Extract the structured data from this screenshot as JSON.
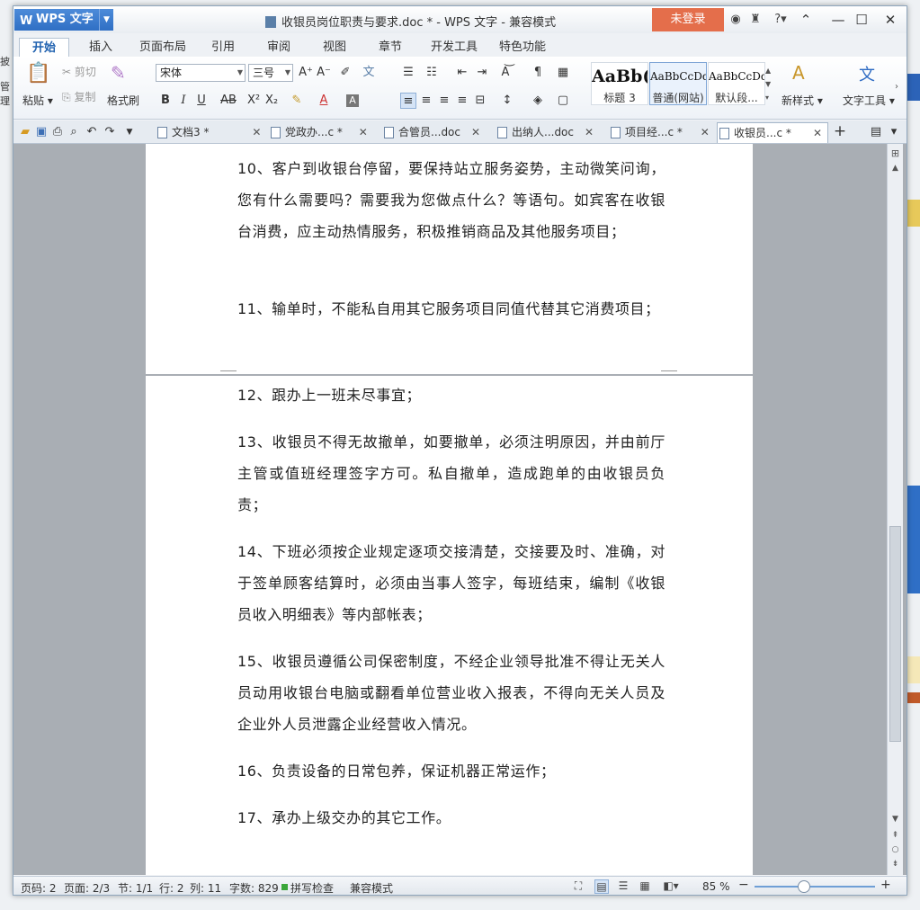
{
  "app": {
    "name": "WPS 文字",
    "window_title": "收银员岗位职责与要求.doc * - WPS 文字 - 兼容模式",
    "login_label": "未登录"
  },
  "desktop": {
    "left_fragments": [
      "披",
      "管理"
    ]
  },
  "ribbon_tabs": [
    {
      "label": "开始",
      "active": true
    },
    {
      "label": "插入"
    },
    {
      "label": "页面布局"
    },
    {
      "label": "引用"
    },
    {
      "label": "审阅"
    },
    {
      "label": "视图"
    },
    {
      "label": "章节"
    },
    {
      "label": "开发工具"
    },
    {
      "label": "特色功能"
    }
  ],
  "ribbon": {
    "paste": "粘贴",
    "cut": "剪切",
    "copy": "复制",
    "format_painter": "格式刷",
    "font_name": "宋体",
    "font_size": "三号",
    "styles": [
      {
        "preview": "AaBb(",
        "label": "标题 3"
      },
      {
        "preview": "AaBbCcDd",
        "label": "普通(网站)",
        "current": true
      },
      {
        "preview": "AaBbCcDd",
        "label": "默认段..."
      }
    ],
    "new_style": "新样式",
    "text_tools": "文字工具"
  },
  "doc_tabs": [
    {
      "label": "文档3 *"
    },
    {
      "label": "党政办...c *"
    },
    {
      "label": "合管员...doc"
    },
    {
      "label": "出纳人...doc"
    },
    {
      "label": "项目经...c *"
    },
    {
      "label": "收银员...c *",
      "active": true
    }
  ],
  "document": {
    "page1_paragraphs": [
      "10、客户到收银台停留，要保持站立服务姿势，主动微笑问询，您有什么需要吗？需要我为您做点什么？等语句。如宾客在收银台消费，应主动热情服务，积极推销商品及其他服务项目；",
      "11、输单时，不能私自用其它服务项目同值代替其它消费项目；"
    ],
    "page2_paragraphs": [
      "12、跟办上一班未尽事宜；",
      "13、收银员不得无故撤单，如要撤单，必须注明原因，并由前厅主管或值班经理签字方可。私自撤单，造成跑单的由收银员负责；",
      "14、下班必须按企业规定逐项交接清楚，交接要及时、准确，对于签单顾客结算时，必须由当事人签字，每班结束，编制《收银员收入明细表》等内部帐表；",
      "15、收银员遵循公司保密制度，不经企业领导批准不得让无关人员动用收银台电脑或翻看单位营业收入报表，不得向无关人员及企业外人员泄露企业经营收入情况。",
      "16、负责设备的日常包养，保证机器正常运作；",
      "17、承办上级交办的其它工作。"
    ]
  },
  "status_bar": {
    "page_code": "页码: 2",
    "page": "页面: 2/3",
    "section": "节: 1/1",
    "row": "行: 2",
    "col": "列: 11",
    "word_count": "字数: 829",
    "spell_check": "拼写检查",
    "compat_mode": "兼容模式",
    "zoom": "85 %"
  },
  "colors": {
    "app_button": "#3f7fd2",
    "login_button": "#e46e4b",
    "active_tab_text": "#2162b0"
  }
}
